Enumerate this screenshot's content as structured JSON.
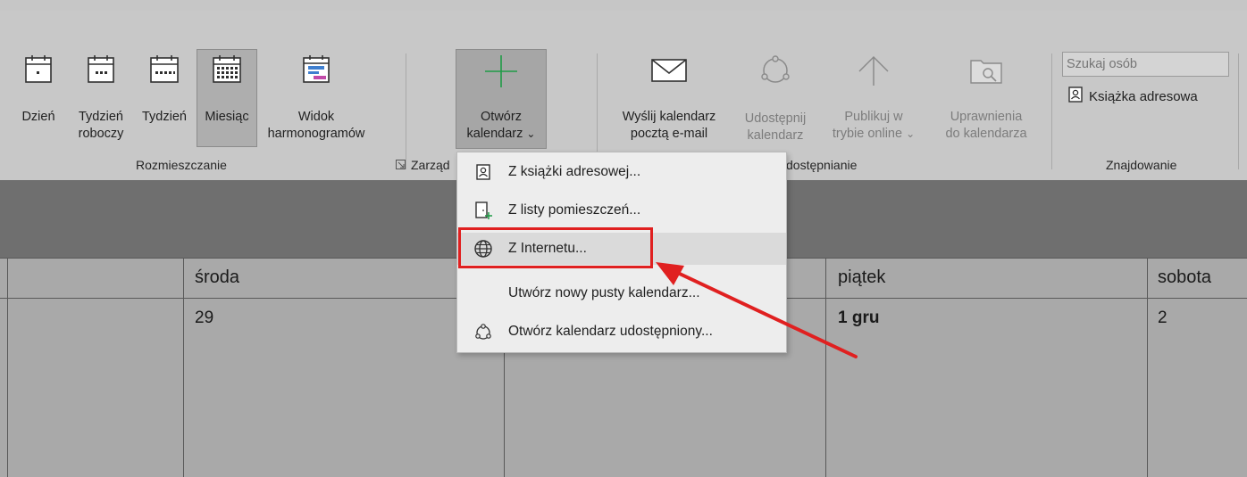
{
  "ribbon": {
    "arrange": {
      "day": "Dzień",
      "work_week": "Tydzień\nroboczy",
      "week": "Tydzień",
      "month": "Miesiąc",
      "schedule_view": "Widok\nharmonogramów",
      "group_label": "Rozmieszczanie",
      "active": "month"
    },
    "manage": {
      "open_calendar": "Otwórz\nkalendarz",
      "group_label_partial": "Zarząd"
    },
    "share": {
      "send_calendar": "Wyślij kalendarz\npocztą e-mail",
      "share_calendar": "Udostępnij\nkalendarz",
      "publish_online": "Publikuj w\ntrybie online",
      "calendar_permissions": "Uprawnienia\ndo kalendarza",
      "group_label_partial": "dostępnianie"
    },
    "find": {
      "search_placeholder": "Szukaj osób",
      "address_book": "Książka adresowa",
      "group_label": "Znajdowanie"
    },
    "dropdown_arrow": "⌄"
  },
  "open_calendar_menu": {
    "items": [
      {
        "label": "Z książki adresowej...",
        "icon": "address-book-icon"
      },
      {
        "label": "Z listy pomieszczeń...",
        "icon": "room-list-icon"
      },
      {
        "label": "Z Internetu...",
        "icon": "globe-icon",
        "highlighted": true
      },
      {
        "label": "Utwórz nowy pusty kalendarz...",
        "icon": ""
      },
      {
        "label": "Otwórz kalendarz udostępniony...",
        "icon": "shared-calendar-icon"
      }
    ]
  },
  "calendar": {
    "days": [
      {
        "name": "środa",
        "date": "29",
        "bold": false
      },
      {
        "name": "piątek",
        "date": "1 gru",
        "bold": true
      },
      {
        "name": "sobota",
        "date": "2",
        "bold": false
      }
    ]
  },
  "annotation": {
    "box_color": "#e02020",
    "arrow_color": "#e02020"
  }
}
